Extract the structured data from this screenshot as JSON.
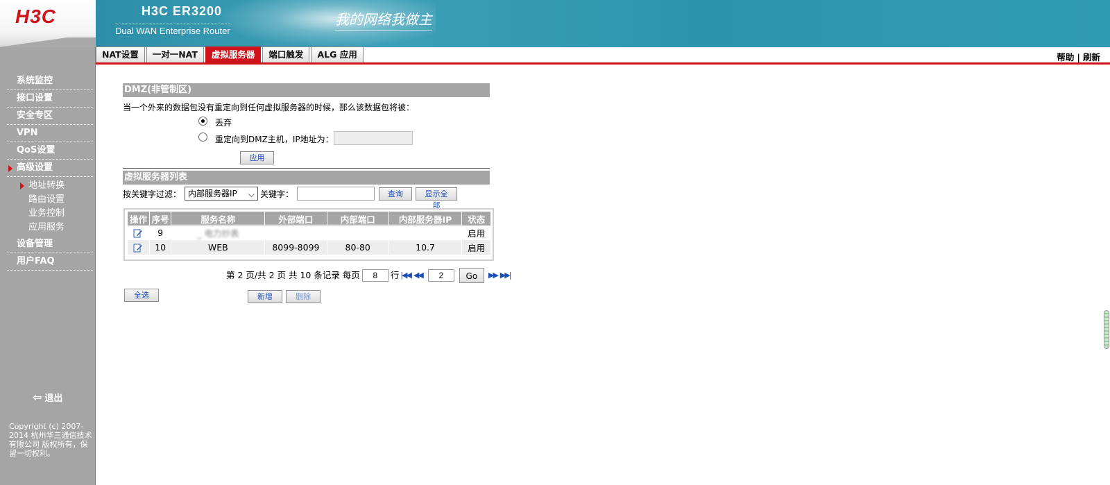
{
  "brand": {
    "logo": "H3C",
    "product_name": "H3C ER3200",
    "product_desc": "Dual WAN Enterprise Router",
    "slogan": "我的网络我做主"
  },
  "tabs": [
    {
      "label": "NAT设置"
    },
    {
      "label": "一对一NAT"
    },
    {
      "label": "虚拟服务器",
      "active": true
    },
    {
      "label": "端口触发"
    },
    {
      "label": "ALG 应用"
    }
  ],
  "top_links": {
    "help": "帮助",
    "separator": "|",
    "refresh": "刷新"
  },
  "sidebar": {
    "items": [
      {
        "label": "系统监控"
      },
      {
        "label": "接口设置"
      },
      {
        "label": "安全专区"
      },
      {
        "label": "VPN"
      },
      {
        "label": "QoS设置"
      },
      {
        "label": "高级设置",
        "active": true,
        "sub_items": [
          {
            "label": "地址转换",
            "active": true
          },
          {
            "label": "路由设置"
          },
          {
            "label": "业务控制"
          },
          {
            "label": "应用服务"
          }
        ]
      },
      {
        "label": "设备管理"
      },
      {
        "label": "用户FAQ"
      }
    ],
    "logout": "退出",
    "copyright": "Copyright (c) 2007-2014  杭州华三通信技术有限公司 版权所有，保留一切权利。"
  },
  "dmz": {
    "title": "DMZ(非管制区)",
    "description": "当一个外来的数据包没有重定向到任何虚拟服务器的时候，那么该数据包将被：",
    "option_discard": "丢弃",
    "option_redirect": "重定向到DMZ主机，IP地址为：",
    "selected": "丢弃",
    "ip_value": "",
    "apply_button": "应用"
  },
  "vs_list": {
    "title": "虚拟服务器列表",
    "filter_label": "按关键字过滤：",
    "filter_select": "内部服务器IP",
    "keyword_label": "关键字：",
    "keyword_value": "",
    "query_button": "查询",
    "show_all_button": "显示全部",
    "columns": [
      "操作",
      "序号",
      "服务名称",
      "外部端口",
      "内部端口",
      "内部服务器IP",
      "状态"
    ],
    "rows": [
      {
        "index": "9",
        "name": "_ 电力抄表",
        "ext_port": "",
        "int_port": "",
        "server_ip": "",
        "status": "启用"
      },
      {
        "index": "10",
        "name": "WEB",
        "ext_port": "8099-8099",
        "int_port": "80-80",
        "server_ip": "10.7",
        "status": "启用"
      }
    ]
  },
  "pager": {
    "text_prefix": "第 2 页/共 2 页 共 10 条记录 每页",
    "per_page": "8",
    "row_unit": "行",
    "page_value": "2",
    "go_button": "Go"
  },
  "actions": {
    "select_all": "全选",
    "add": "新增",
    "delete": "删除"
  },
  "colors": {
    "accent_red": "#d0121b",
    "header_gray": "#a5a5a5",
    "banner_teal": "#2f9bb3"
  },
  "icons": {
    "edit": "edit-icon",
    "first": "first-page-icon",
    "prev": "prev-page-icon",
    "next": "next-page-icon",
    "last": "last-page-icon",
    "logout": "logout-icon"
  }
}
